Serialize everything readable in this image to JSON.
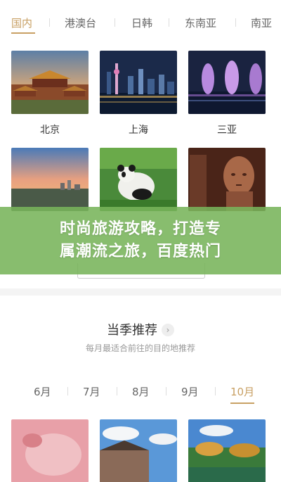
{
  "region_tabs": [
    "国内",
    "港澳台",
    "日韩",
    "东南亚",
    "南亚"
  ],
  "active_region": "国内",
  "cities": [
    "北京",
    "上海",
    "三亚"
  ],
  "promo": {
    "line1": "时尚旅游攻略，打造专",
    "line2": "属潮流之旅，百度热门"
  },
  "season": {
    "title": "当季推荐",
    "subtitle": "每月最适合前往的目的地推荐"
  },
  "months": [
    "6月",
    "7月",
    "8月",
    "9月",
    "10月"
  ],
  "active_month": "10月",
  "colors": {
    "accent": "#c8a064",
    "banner": "#78b45a"
  }
}
